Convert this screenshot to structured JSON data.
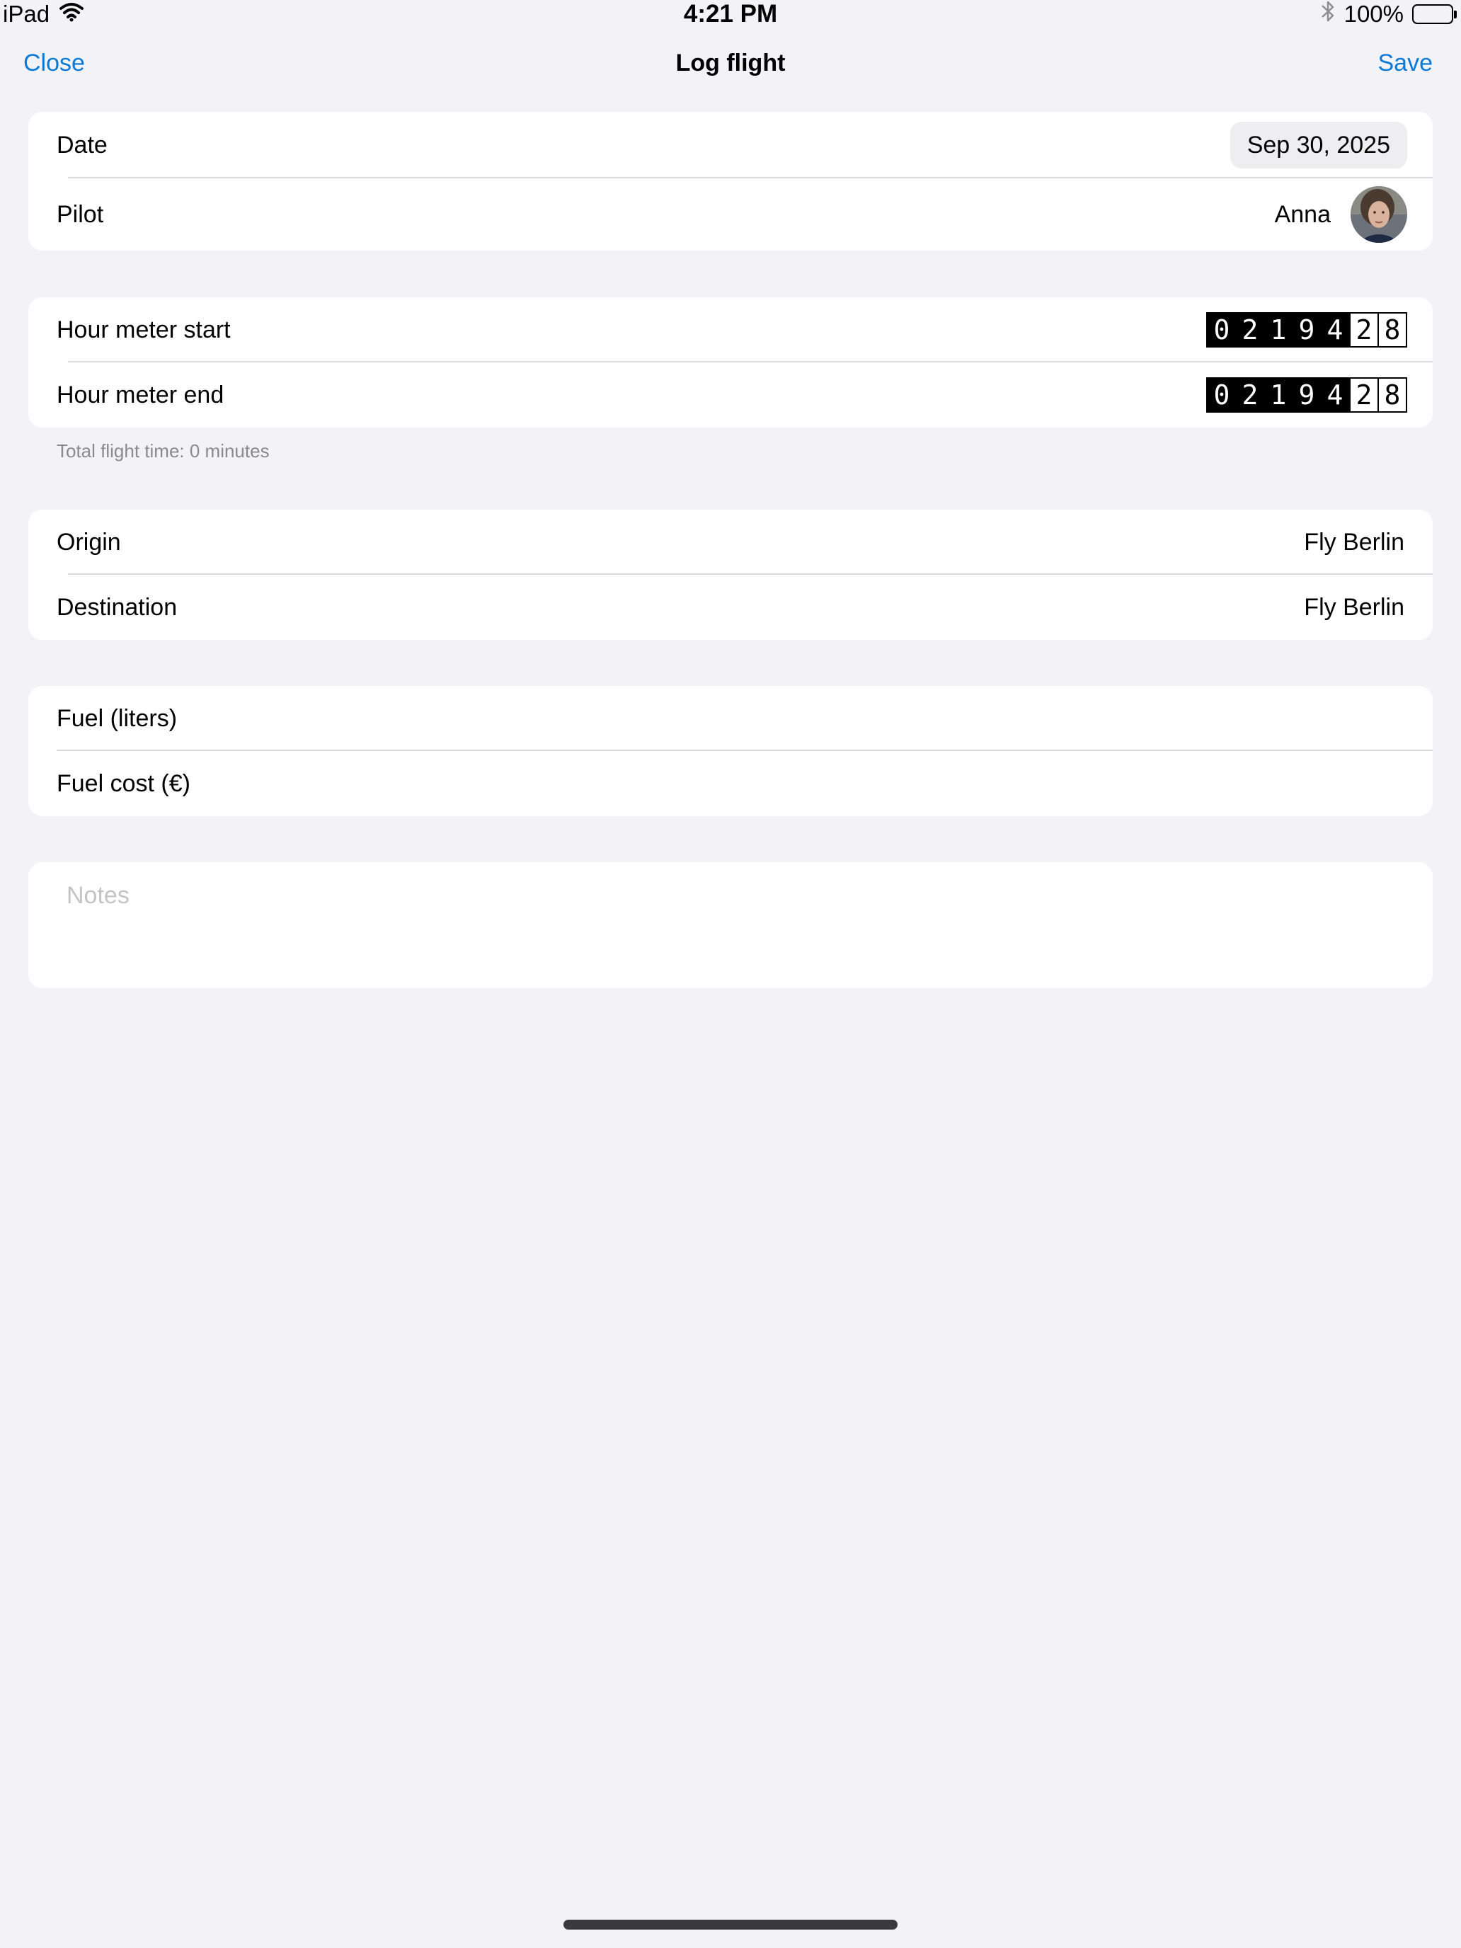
{
  "status": {
    "device": "iPad",
    "time": "4:21 PM",
    "battery": "100%",
    "battery_level": 1.0,
    "icons": [
      "wifi-icon",
      "bluetooth-icon",
      "battery-icon"
    ]
  },
  "nav": {
    "close": "Close",
    "title": "Log flight",
    "save": "Save",
    "accent_color": "#0a7ad8"
  },
  "date_pilot": {
    "date_label": "Date",
    "date_value": "Sep 30, 2025",
    "pilot_label": "Pilot",
    "pilot_value": "Anna"
  },
  "hour_meter": {
    "start_label": "Hour meter start",
    "end_label": "Hour meter end",
    "start_digits": [
      "0",
      "2",
      "1",
      "9",
      "4",
      "2",
      "8"
    ],
    "end_digits": [
      "0",
      "2",
      "1",
      "9",
      "4",
      "2",
      "8"
    ],
    "footnote": "Total flight time: 0 minutes"
  },
  "route": {
    "origin_label": "Origin",
    "origin_value": "Fly Berlin",
    "destination_label": "Destination",
    "destination_value": "Fly Berlin"
  },
  "fuel": {
    "liters_label": "Fuel (liters)",
    "cost_label": "Fuel cost (€)"
  },
  "notes": {
    "placeholder": "Notes"
  }
}
